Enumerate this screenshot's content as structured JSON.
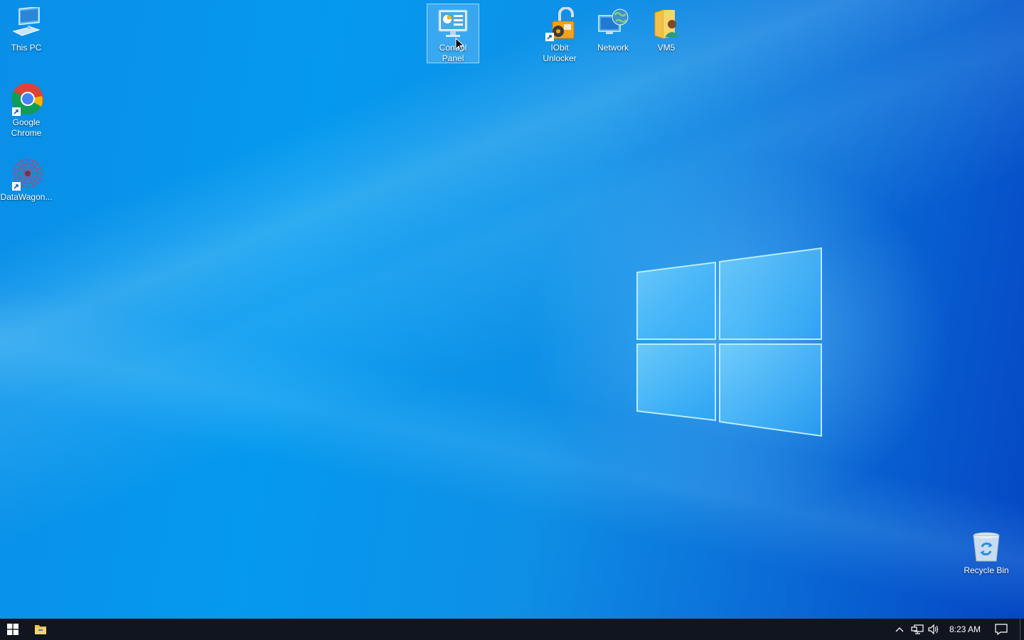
{
  "desktop": {
    "icons": [
      {
        "label": "This PC",
        "icon": "this-pc-icon"
      },
      {
        "label": "Google Chrome",
        "icon": "chrome-icon"
      },
      {
        "label": "DataWagon...",
        "icon": "datawagon-icon"
      },
      {
        "label": "Control Panel",
        "icon": "control-panel-icon",
        "selected": true
      },
      {
        "label": "IObit Unlocker",
        "icon": "iobit-unlocker-icon"
      },
      {
        "label": "Network",
        "icon": "network-icon"
      },
      {
        "label": "VM5",
        "icon": "user-folder-icon"
      },
      {
        "label": "Recycle Bin",
        "icon": "recycle-bin-icon"
      }
    ]
  },
  "taskbar": {
    "start_icon": "windows-start-icon",
    "pinned": [
      {
        "icon": "file-explorer-icon"
      }
    ],
    "tray": {
      "icons": [
        "chevron-up-icon",
        "network-icon",
        "speaker-icon"
      ],
      "clock": "8:23 AM",
      "notification_icon": "action-center-icon"
    },
    "color": "#10151f"
  },
  "colors": {
    "wallpaper_light": "#0599ef",
    "wallpaper_dark": "#0446c4",
    "selection": "#b4dcff"
  }
}
